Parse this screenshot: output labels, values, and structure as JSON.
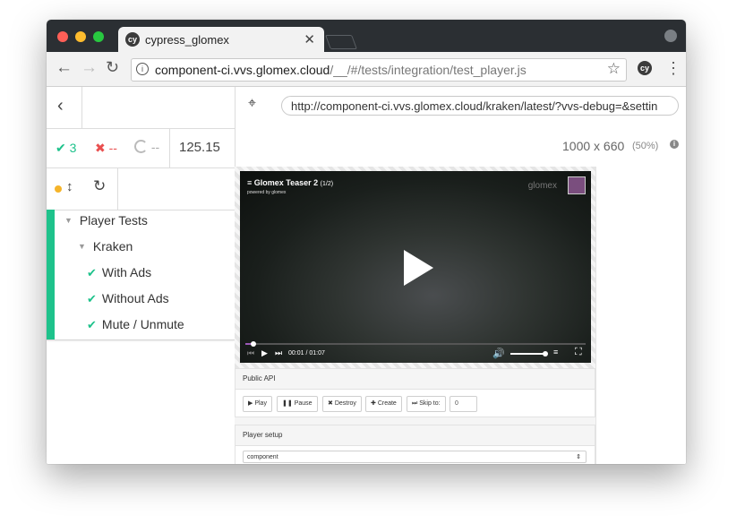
{
  "browser": {
    "tab_title": "cypress_glomex",
    "tab_close": "✕",
    "url_host": "component-ci.vvs.glomex.cloud",
    "url_path": "/__/#/tests/integration/test_player.js",
    "colors": {
      "close": "#ff5f57",
      "minimize": "#febc2e",
      "maximize": "#28c840"
    }
  },
  "runner": {
    "back_icon": "chevron-left-icon",
    "selector_icon": "crosshair-icon",
    "aut_url": "http://component-ci.vvs.glomex.cloud/kraken/latest/?vvs-debug=&settin",
    "stats": {
      "passed": "3",
      "failed": "--",
      "pending": "--",
      "duration": "125.15"
    },
    "viewport": {
      "size": "1000 x 660",
      "scale": "(50%)"
    },
    "colors": {
      "passed": "#1ec28b",
      "failed": "#e94f4f",
      "pending": "#bbbbbb",
      "dot": "#f5b42a"
    }
  },
  "tests": {
    "suite": "Player Tests",
    "subsuite": "Kraken",
    "items": [
      {
        "label": "With Ads"
      },
      {
        "label": "Without Ads"
      },
      {
        "label": "Mute / Unmute"
      }
    ]
  },
  "player": {
    "title": "Glomex Teaser 2",
    "count": "(1/2)",
    "powered_by": "powered by glomex",
    "brand": "glomex",
    "time": "00:01 / 01:07",
    "progress": 0.02,
    "volume": 1.0
  },
  "public_api": {
    "title": "Public API",
    "buttons": {
      "play": "Play",
      "pause": "Pause",
      "destroy": "Destroy",
      "create": "Create",
      "skip": "Skip to:"
    },
    "skip_value": "0"
  },
  "player_setup": {
    "title": "Player setup",
    "select_value": "component"
  }
}
